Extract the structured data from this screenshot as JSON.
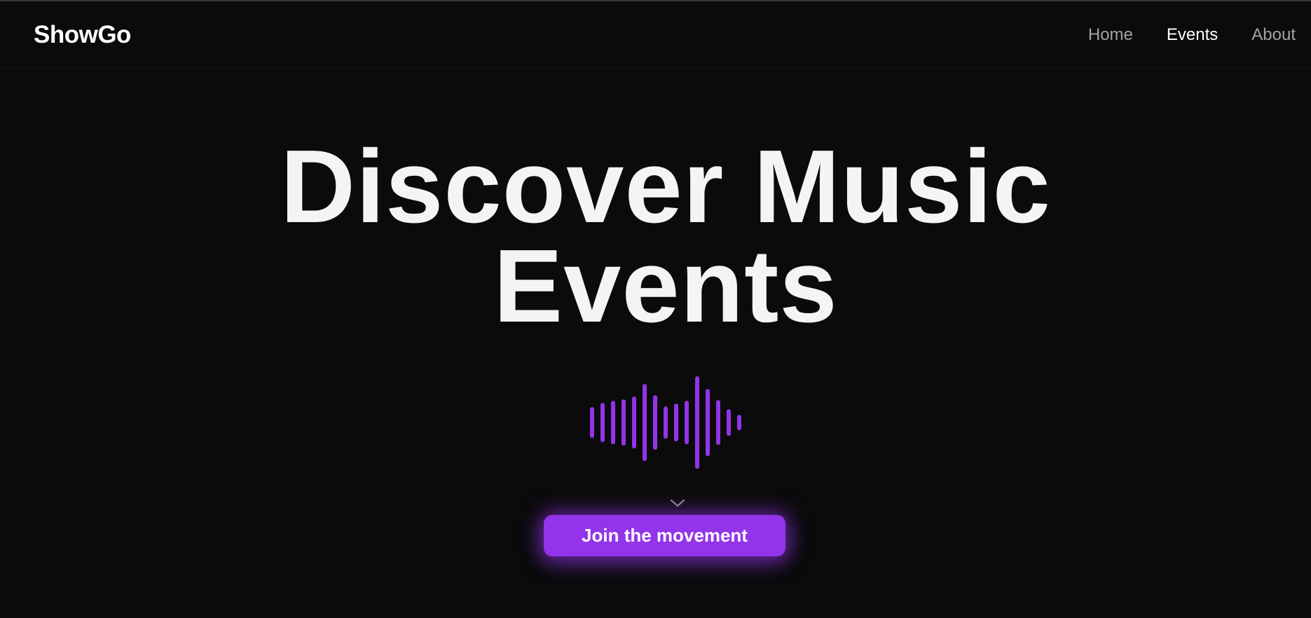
{
  "header": {
    "brand": "ShowGo",
    "nav": [
      {
        "label": "Home",
        "active": false
      },
      {
        "label": "Events",
        "active": true
      },
      {
        "label": "About",
        "active": false
      }
    ]
  },
  "hero": {
    "title_line1": "Discover Music",
    "title_line2": "Events",
    "waveform_icon": "audio-waveform-icon",
    "scroll_icon": "chevron-down-icon",
    "cta_label": "Join the movement"
  },
  "colors": {
    "background": "#0b0b0b",
    "accent": "#9333ea",
    "text": "#f5f5f5",
    "nav_inactive": "#a3a3a3"
  }
}
